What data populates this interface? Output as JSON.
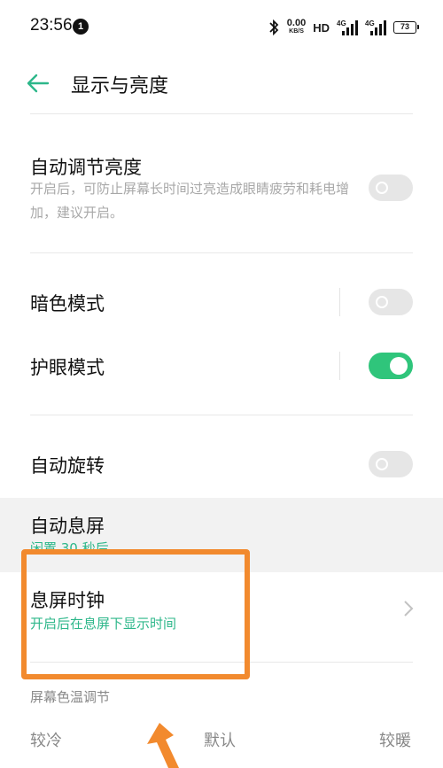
{
  "status_bar": {
    "time": "23:56",
    "notification_count": "1",
    "net_speed_value": "0.00",
    "net_speed_unit": "KB/S",
    "hd_label": "HD",
    "signal_1_label": "4G",
    "signal_2_label": "4G",
    "battery": "73"
  },
  "header": {
    "title": "显示与亮度",
    "back_icon": "arrow-left-icon"
  },
  "settings": {
    "auto_brightness": {
      "title": "自动调节亮度",
      "description": "开启后，可防止屏幕长时间过亮造成眼睛疲劳和耗电增加，建议开启。",
      "enabled": false
    },
    "dark_mode": {
      "title": "暗色模式",
      "enabled": false
    },
    "eye_care": {
      "title": "护眼模式",
      "enabled": true
    },
    "auto_rotate": {
      "title": "自动旋转",
      "enabled": false
    },
    "screen_timeout": {
      "title": "自动息屏",
      "value": "闲置 30 秒后"
    },
    "screen_off_clock": {
      "title": "息屏时钟",
      "description": "开启后在息屏下显示时间"
    },
    "color_temperature": {
      "section_label": "屏幕色温调节",
      "cool_label": "较冷",
      "default_label": "默认",
      "warm_label": "较暖"
    }
  },
  "colors": {
    "accent": "#2fc57b",
    "accent_text": "#2db78a",
    "annotation": "#f28a2e"
  }
}
